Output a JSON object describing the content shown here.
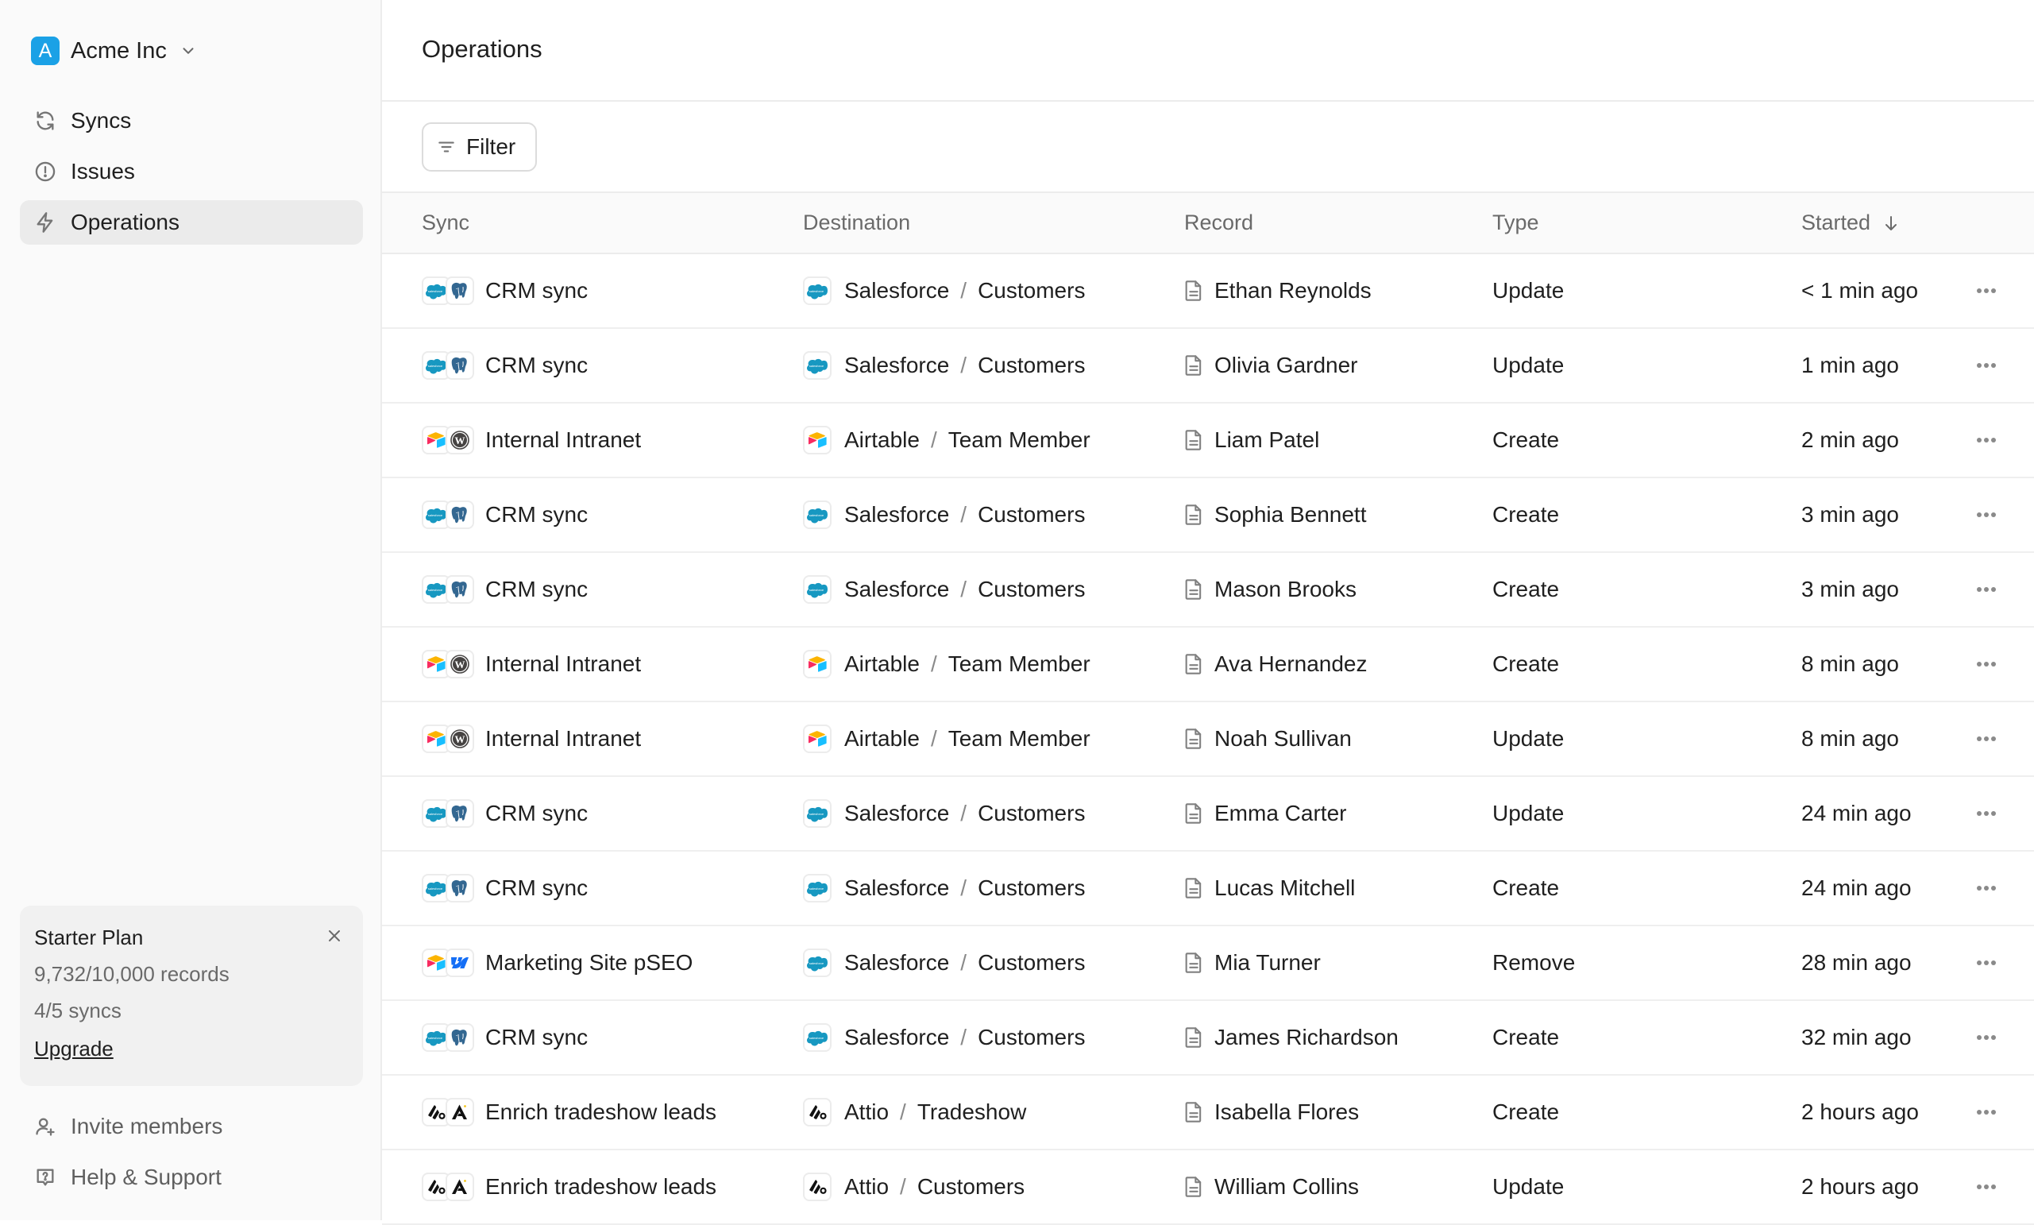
{
  "sidebar": {
    "org": {
      "initial": "A",
      "name": "Acme Inc",
      "logo_color": "#1ba1e6"
    },
    "nav": [
      {
        "label": "Syncs",
        "icon": "refresh-icon",
        "active": false
      },
      {
        "label": "Issues",
        "icon": "alert-circle-icon",
        "active": false
      },
      {
        "label": "Operations",
        "icon": "bolt-icon",
        "active": true
      }
    ],
    "plan": {
      "title": "Starter Plan",
      "records": "9,732/10,000 records",
      "syncs": "4/5 syncs",
      "upgrade": "Upgrade"
    },
    "footer": [
      {
        "label": "Invite members",
        "icon": "user-plus-icon"
      },
      {
        "label": "Help & Support",
        "icon": "help-message-icon"
      }
    ]
  },
  "header": {
    "title": "Operations"
  },
  "toolbar": {
    "filter_label": "Filter"
  },
  "table": {
    "columns": [
      "Sync",
      "Destination",
      "Record",
      "Type",
      "Started"
    ],
    "sort": {
      "column": "Started",
      "direction": "descending"
    },
    "rows": [
      {
        "sync": "CRM sync",
        "sync_icons": [
          "salesforce",
          "postgres"
        ],
        "dest_app": "Salesforce",
        "dest_obj": "Customers",
        "dest_icon": "salesforce",
        "record": "Ethan Reynolds",
        "type": "Update",
        "started": "< 1 min ago"
      },
      {
        "sync": "CRM sync",
        "sync_icons": [
          "salesforce",
          "postgres"
        ],
        "dest_app": "Salesforce",
        "dest_obj": "Customers",
        "dest_icon": "salesforce",
        "record": "Olivia Gardner",
        "type": "Update",
        "started": "1 min ago"
      },
      {
        "sync": "Internal Intranet",
        "sync_icons": [
          "airtable",
          "wordpress"
        ],
        "dest_app": "Airtable",
        "dest_obj": "Team Member",
        "dest_icon": "airtable",
        "record": "Liam Patel",
        "type": "Create",
        "started": "2 min ago"
      },
      {
        "sync": "CRM sync",
        "sync_icons": [
          "salesforce",
          "postgres"
        ],
        "dest_app": "Salesforce",
        "dest_obj": "Customers",
        "dest_icon": "salesforce",
        "record": "Sophia Bennett",
        "type": "Create",
        "started": "3 min ago"
      },
      {
        "sync": "CRM sync",
        "sync_icons": [
          "salesforce",
          "postgres"
        ],
        "dest_app": "Salesforce",
        "dest_obj": "Customers",
        "dest_icon": "salesforce",
        "record": "Mason Brooks",
        "type": "Create",
        "started": "3 min ago"
      },
      {
        "sync": "Internal Intranet",
        "sync_icons": [
          "airtable",
          "wordpress"
        ],
        "dest_app": "Airtable",
        "dest_obj": "Team Member",
        "dest_icon": "airtable",
        "record": "Ava Hernandez",
        "type": "Create",
        "started": "8 min ago"
      },
      {
        "sync": "Internal Intranet",
        "sync_icons": [
          "airtable",
          "wordpress"
        ],
        "dest_app": "Airtable",
        "dest_obj": "Team Member",
        "dest_icon": "airtable",
        "record": "Noah Sullivan",
        "type": "Update",
        "started": "8 min ago"
      },
      {
        "sync": "CRM sync",
        "sync_icons": [
          "salesforce",
          "postgres"
        ],
        "dest_app": "Salesforce",
        "dest_obj": "Customers",
        "dest_icon": "salesforce",
        "record": "Emma Carter",
        "type": "Update",
        "started": "24 min ago"
      },
      {
        "sync": "CRM sync",
        "sync_icons": [
          "salesforce",
          "postgres"
        ],
        "dest_app": "Salesforce",
        "dest_obj": "Customers",
        "dest_icon": "salesforce",
        "record": "Lucas Mitchell",
        "type": "Create",
        "started": "24 min ago"
      },
      {
        "sync": "Marketing Site pSEO",
        "sync_icons": [
          "airtable",
          "webflow"
        ],
        "dest_app": "Salesforce",
        "dest_obj": "Customers",
        "dest_icon": "salesforce",
        "record": "Mia Turner",
        "type": "Remove",
        "started": "28 min ago"
      },
      {
        "sync": "CRM sync",
        "sync_icons": [
          "salesforce",
          "postgres"
        ],
        "dest_app": "Salesforce",
        "dest_obj": "Customers",
        "dest_icon": "salesforce",
        "record": "James Richardson",
        "type": "Create",
        "started": "32 min ago"
      },
      {
        "sync": "Enrich tradeshow leads",
        "sync_icons": [
          "attio",
          "apollo"
        ],
        "dest_app": "Attio",
        "dest_obj": "Tradeshow",
        "dest_icon": "attio",
        "record": "Isabella Flores",
        "type": "Create",
        "started": "2 hours ago"
      },
      {
        "sync": "Enrich tradeshow leads",
        "sync_icons": [
          "attio",
          "apollo"
        ],
        "dest_app": "Attio",
        "dest_obj": "Customers",
        "dest_icon": "attio",
        "record": "William Collins",
        "type": "Update",
        "started": "2 hours ago"
      }
    ]
  },
  "colors": {
    "salesforce": "#1798c1",
    "postgres": "#336791",
    "airtable_yellow": "#fcb400",
    "airtable_red": "#f82b60",
    "airtable_blue": "#18bfff",
    "wordpress": "#464342",
    "webflow": "#146ef5",
    "attio": "#111111"
  }
}
